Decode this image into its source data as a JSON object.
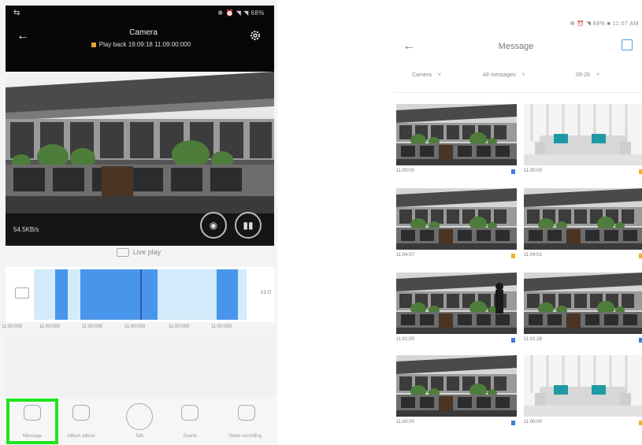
{
  "left_screen": {
    "statusbar": {
      "left": "⇆",
      "right": "☸ ⏰ ◥ ◥ 68%"
    },
    "header": {
      "title": "Camera",
      "playback_text": "Play back 19:09:18 11:09:00:000"
    },
    "video": {
      "speed": "54.5KB/s"
    },
    "live_play_label": "Live play",
    "timeline": {
      "zoom_label": "x1.0",
      "ticks": [
        "11:00:000",
        "11:00:000",
        "11:00:000",
        "11:00:000",
        "11:00:000",
        "11:00:000"
      ],
      "recorded_segments": [
        {
          "start": 0.1,
          "end": 0.16
        },
        {
          "start": 0.22,
          "end": 0.49
        },
        {
          "start": 0.49,
          "end": 0.58
        },
        {
          "start": 0.86,
          "end": 0.96
        }
      ],
      "cursor_position": 0.5
    },
    "toolbar": [
      {
        "key": "message",
        "label": "Message"
      },
      {
        "key": "album",
        "label": "Album album"
      },
      {
        "key": "talk",
        "label": "Talk"
      },
      {
        "key": "sound",
        "label": "Sound"
      },
      {
        "key": "record",
        "label": "Video recording"
      }
    ]
  },
  "right_screen": {
    "status": "☸ ⏰ ◥ 68% ■ 11:07 AM",
    "title": "Message",
    "filters": [
      {
        "label": "Camera",
        "arrow": "˅"
      },
      {
        "label": "All messages",
        "arrow": "˅"
      },
      {
        "label": "09-26",
        "arrow": "˅"
      }
    ],
    "messages": [
      {
        "time": "11:00:00",
        "scene": "building",
        "badge": "blue"
      },
      {
        "time": "11:00:00",
        "scene": "room",
        "badge": "yellow"
      },
      {
        "time": "11:04:07",
        "scene": "building",
        "badge": "yellow"
      },
      {
        "time": "11:04:01",
        "scene": "building",
        "badge": "yellow"
      },
      {
        "time": "11:01:00",
        "scene": "building-person",
        "badge": "blue"
      },
      {
        "time": "11:01:28",
        "scene": "building",
        "badge": "blue"
      },
      {
        "time": "11:00:00",
        "scene": "building",
        "badge": "blue"
      },
      {
        "time": "11:00:00",
        "scene": "room",
        "badge": "yellow"
      }
    ]
  },
  "colors": {
    "highlight": "#1ee31e",
    "timeline_bg": "#d3ebfa",
    "timeline_segment": "#4a95ec",
    "accent_blue": "#4a9ef0",
    "badge_blue": "#3b7fd9",
    "badge_yellow": "#f0b323"
  }
}
